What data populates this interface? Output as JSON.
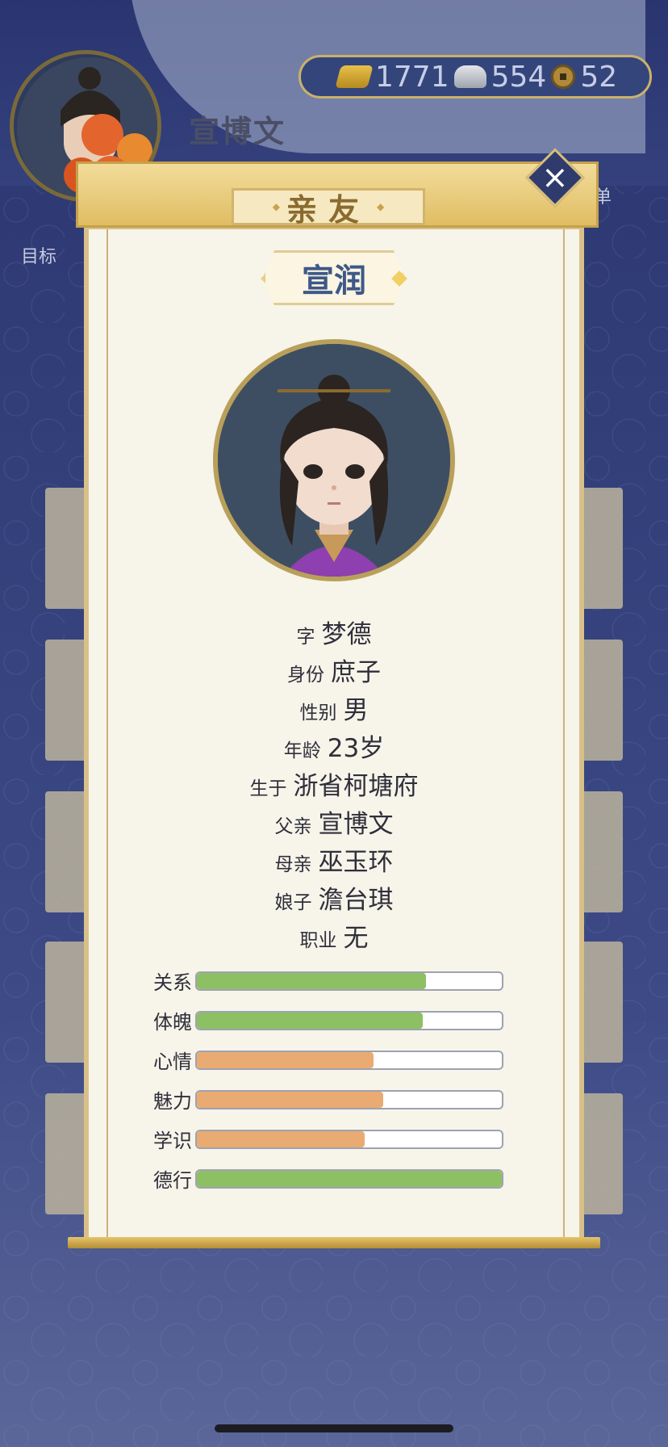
{
  "header": {
    "player_name": "宣博文",
    "currency": {
      "gold": "1771",
      "silver": "554",
      "copper": "52"
    },
    "left_label": "目标",
    "right_label": "单"
  },
  "modal": {
    "title": "亲友",
    "character_name": "宣润",
    "info": [
      {
        "key": "字",
        "value": "梦德"
      },
      {
        "key": "身份",
        "value": "庶子"
      },
      {
        "key": "性别",
        "value": "男"
      },
      {
        "key": "年龄",
        "value": "23岁"
      },
      {
        "key": "生于",
        "value": "浙省柯塘府"
      },
      {
        "key": "父亲",
        "value": "宣博文"
      },
      {
        "key": "母亲",
        "value": "巫玉环"
      },
      {
        "key": "娘子",
        "value": "澹台琪"
      },
      {
        "key": "职业",
        "value": "无"
      }
    ],
    "stats": [
      {
        "label": "关系",
        "level": 0.75,
        "color": "#8dc063"
      },
      {
        "label": "体魄",
        "level": 0.74,
        "color": "#8dc063"
      },
      {
        "label": "心情",
        "level": 0.58,
        "color": "#e9ab72"
      },
      {
        "label": "魅力",
        "level": 0.61,
        "color": "#e9ab72"
      },
      {
        "label": "学识",
        "level": 0.55,
        "color": "#e9ab72"
      },
      {
        "label": "德行",
        "level": 1.0,
        "color": "#8dc063"
      }
    ]
  },
  "colors": {
    "accent": "#d8c089",
    "name": "#3e5888"
  }
}
